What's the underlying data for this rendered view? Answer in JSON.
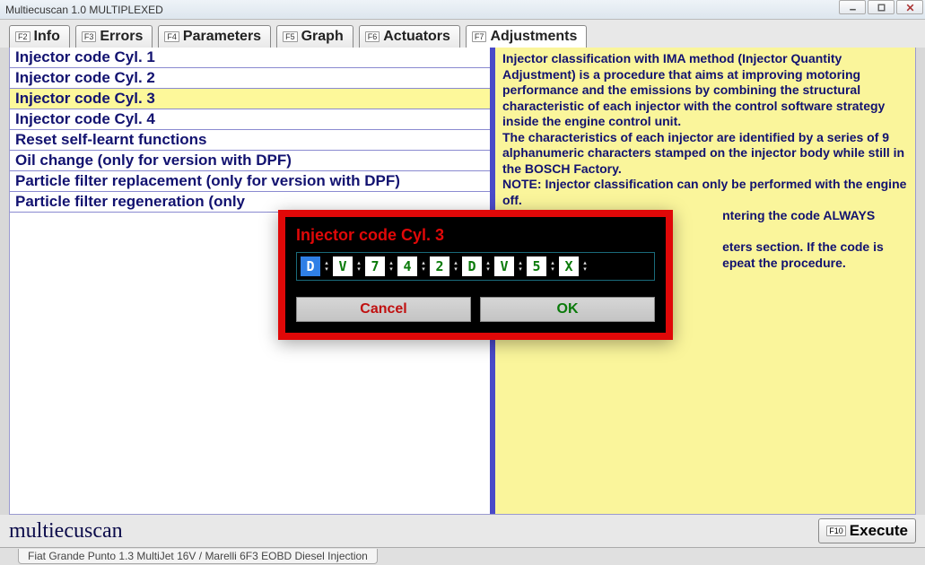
{
  "window": {
    "title": "Multiecuscan 1.0 MULTIPLEXED"
  },
  "tabs": [
    {
      "fkey": "F2",
      "label": "Info"
    },
    {
      "fkey": "F3",
      "label": "Errors"
    },
    {
      "fkey": "F4",
      "label": "Parameters"
    },
    {
      "fkey": "F5",
      "label": "Graph"
    },
    {
      "fkey": "F6",
      "label": "Actuators"
    },
    {
      "fkey": "F7",
      "label": "Adjustments"
    }
  ],
  "active_tab_index": 5,
  "adjustments": [
    "Injector code Cyl. 1",
    "Injector code Cyl. 2",
    "Injector code Cyl. 3",
    "Injector code Cyl. 4",
    "Reset self-learnt functions",
    "Oil change (only for version with DPF)",
    "Particle filter replacement (only for version with DPF)",
    "Particle filter regeneration (only"
  ],
  "selected_adjustment_index": 2,
  "info_text": "Injector classification with IMA method (Injector Quantity Adjustment) is a procedure that aims at improving motoring performance and the emissions by combining the structural characteristic of each injector with the control software strategy inside the engine control unit.\nThe characteristics of each injector are identified by a series of 9 alphanumeric characters stamped on the injector body while still in the BOSCH Factory.\nNOTE: Injector classification can only be performed with the engine off.\n                                                               ntering the code ALWAYS check\n                                                               eters section. If the code is\n                                                               epeat the procedure.",
  "footer": {
    "brand": "multiecuscan",
    "execute_fkey": "F10",
    "execute_label": "Execute"
  },
  "status": {
    "vehicle": "Fiat Grande Punto 1.3 MultiJet 16V / Marelli 6F3 EOBD Diesel Injection"
  },
  "modal": {
    "title": "Injector code Cyl. 3",
    "code": [
      "D",
      "V",
      "7",
      "4",
      "2",
      "D",
      "V",
      "5",
      "X"
    ],
    "selected_index": 0,
    "cancel_label": "Cancel",
    "ok_label": "OK"
  }
}
